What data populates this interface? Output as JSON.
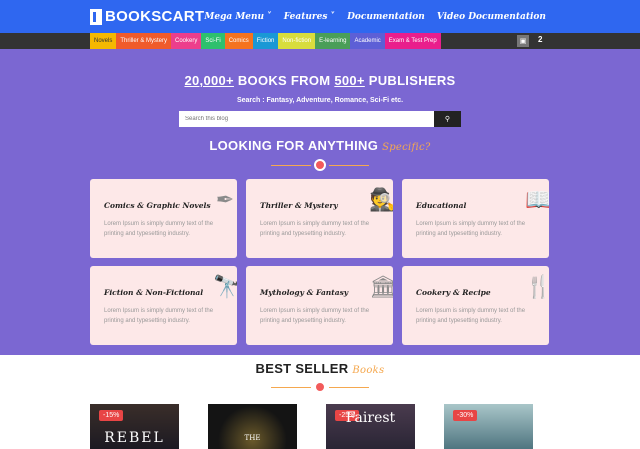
{
  "brand": {
    "name": "BOOKSCART"
  },
  "nav": {
    "items": [
      "Mega Menu ˅",
      "Features ˅",
      "Documentation",
      "Video Documentation"
    ]
  },
  "categories": [
    {
      "label": "Novels",
      "color": "#f5b800"
    },
    {
      "label": "Thriller & Mystery",
      "color": "#f05b2b"
    },
    {
      "label": "Cookery",
      "color": "#ec3e8c"
    },
    {
      "label": "Sci-Fi",
      "color": "#2ec06d"
    },
    {
      "label": "Comics",
      "color": "#f5731f"
    },
    {
      "label": "Fiction",
      "color": "#1a98d5"
    },
    {
      "label": "Non-fiction",
      "color": "#d8dd3d"
    },
    {
      "label": "E-learning",
      "color": "#4a9e58"
    },
    {
      "label": "Academic",
      "color": "#5d5fd6"
    },
    {
      "label": "Exam & Test Prep",
      "color": "#e91e8c"
    }
  ],
  "cart": {
    "count": "2"
  },
  "hero": {
    "headline_a": "20,000+",
    "headline_b": " BOOKS FROM ",
    "headline_c": "500+",
    "headline_d": " PUBLISHERS",
    "subline": "Search : Fantasy, Adventure, Romance, Sci-Fi etc.",
    "search_placeholder": "Search this blog",
    "section_title": "LOOKING FOR ANYTHING",
    "section_accent": "Specific?"
  },
  "cards": [
    {
      "title": "Comics & Graphic Novels",
      "desc": "Lorem Ipsum is simply dummy text of the printing and typesetting industry.",
      "icon": "✒"
    },
    {
      "title": "Thriller & Mystery",
      "desc": "Lorem Ipsum is simply dummy text of the printing and typesetting industry.",
      "icon": "🕵"
    },
    {
      "title": "Educational",
      "desc": "Lorem Ipsum is simply dummy text of the printing and typesetting industry.",
      "icon": "📖"
    },
    {
      "title": "Fiction & Non-Fictional",
      "desc": "Lorem Ipsum is simply dummy text of the printing and typesetting industry.",
      "icon": "🔭"
    },
    {
      "title": "Mythology & Fantasy",
      "desc": "Lorem Ipsum is simply dummy text of the printing and typesetting industry.",
      "icon": "🏛"
    },
    {
      "title": "Cookery & Recipe",
      "desc": "Lorem Ipsum is simply dummy text of the printing and typesetting industry.",
      "icon": "🍴"
    }
  ],
  "bestseller": {
    "title": "BEST SELLER",
    "accent": "Books"
  },
  "books": [
    {
      "badge": "-15%",
      "title": "REBEL"
    },
    {
      "badge": "",
      "title": "THE"
    },
    {
      "badge": "-25%",
      "title": "Fairest"
    },
    {
      "badge": "-30%",
      "title": ""
    }
  ]
}
